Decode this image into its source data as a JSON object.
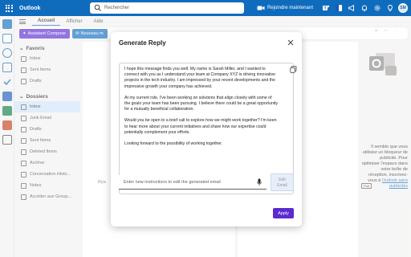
{
  "titlebar": {
    "app_name": "Outlook",
    "search_placeholder": "Rechercher",
    "meet_now_label": "Rejoindre maintenant",
    "avatar_initials": "SM"
  },
  "ribbon": {
    "tabs": [
      "Accueil",
      "Afficher",
      "Aide"
    ],
    "assistant_label": "Assistant Compose",
    "new_label": "Nouveau m"
  },
  "folders": {
    "favorites_header": "Favoris",
    "favorites": [
      "Inbox",
      "Sent Items",
      "Drafts"
    ],
    "folders_header": "Dossiers",
    "items": [
      "Inbox",
      "Junk Email",
      "Drafts",
      "Sent Items",
      "Deleted Items",
      "Archive",
      "Conversation Histo...",
      "Notes",
      "Accéder aux Group..."
    ]
  },
  "msglist": {
    "partial_label": "Rya"
  },
  "ad": {
    "text": "Il semble que vous utilisiez un bloqueur de publicité. Pour optimiser l'espace dans votre boîte de réception, inscrivez-vous à",
    "link": "Outlook sans publicités",
    "badge": "Pub"
  },
  "dialog": {
    "title": "Generate Reply",
    "paragraphs": [
      "I hope this message finds you well. My name is Sarah Miller, and I wanted to connect with you as I understand your team at Company XYZ is driving innovative projects in the tech industry. I am impressed by your recent developments and the impressive growth your company has achieved.",
      "At my current role, I've been working on solutions that align closely with some of the goals your team has been pursuing. I believe there could be a great opportunity for a mutually beneficial collaboration.",
      "Would you be open to a brief call to explore how we might work together? I'm keen to hear more about your current initiatives and share how our expertise could potentially complement your efforts.",
      "Looking forward to the possibility of working together."
    ],
    "instructions_placeholder": "Enter new instructions to edit the generated email",
    "edit_label_1": "Edit",
    "edit_label_2": "Email",
    "apply_label": "Apply"
  },
  "colors": {
    "brand_blue": "#0f6cbd",
    "copilot_purple": "#5b2ad1"
  }
}
